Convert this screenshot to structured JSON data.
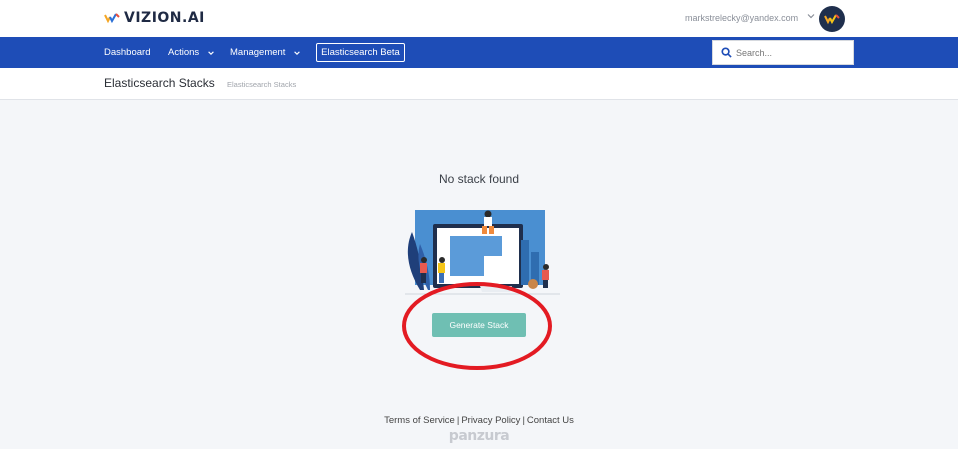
{
  "brand": {
    "name": "VIZION.AI"
  },
  "user": {
    "email": "markstrelecky@yandex.com"
  },
  "nav": {
    "items": [
      {
        "label": "Dashboard",
        "has_dropdown": false
      },
      {
        "label": "Actions",
        "has_dropdown": true
      },
      {
        "label": "Management",
        "has_dropdown": true
      }
    ],
    "active": "Elasticsearch Beta"
  },
  "search": {
    "placeholder": "Search..."
  },
  "page": {
    "title": "Elasticsearch Stacks",
    "breadcrumb": "Elasticsearch Stacks"
  },
  "empty_state": {
    "message": "No stack found",
    "button_label": "Generate Stack"
  },
  "footer": {
    "links": [
      "Terms of Service",
      "Privacy Policy",
      "Contact Us"
    ],
    "brand": "panzura"
  },
  "colors": {
    "nav_bg": "#1e4db7",
    "button": "#6fbfb3",
    "annotation": "#e31b23"
  }
}
